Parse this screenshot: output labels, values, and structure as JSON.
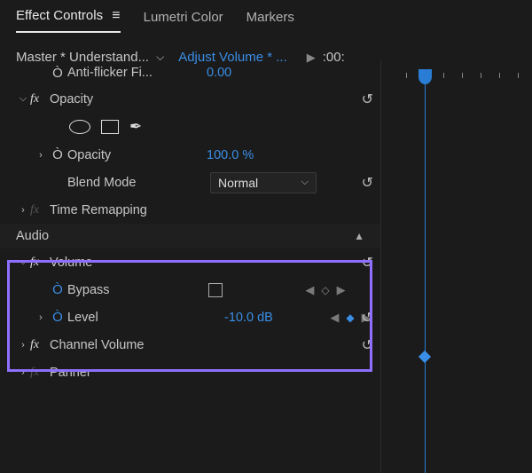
{
  "tabs": {
    "effect_controls": "Effect Controls",
    "lumetri_color": "Lumetri Color",
    "markers": "Markers"
  },
  "breadcrumb": {
    "master": "Master * Understand...",
    "clip": "Adjust Volume * ...",
    "timecode": ":00:"
  },
  "props": {
    "anti_flicker": {
      "label": "Anti-flicker Fi...",
      "value": "0.00"
    },
    "opacity_fx": "Opacity",
    "opacity": {
      "label": "Opacity",
      "value": "100.0 %"
    },
    "blend_mode": {
      "label": "Blend Mode",
      "value": "Normal"
    },
    "time_remap": "Time Remapping",
    "audio_section": "Audio",
    "volume_fx": "Volume",
    "bypass": {
      "label": "Bypass"
    },
    "level": {
      "label": "Level",
      "value": "-10.0 dB"
    },
    "channel_volume": "Channel Volume",
    "panner": "Panner"
  }
}
